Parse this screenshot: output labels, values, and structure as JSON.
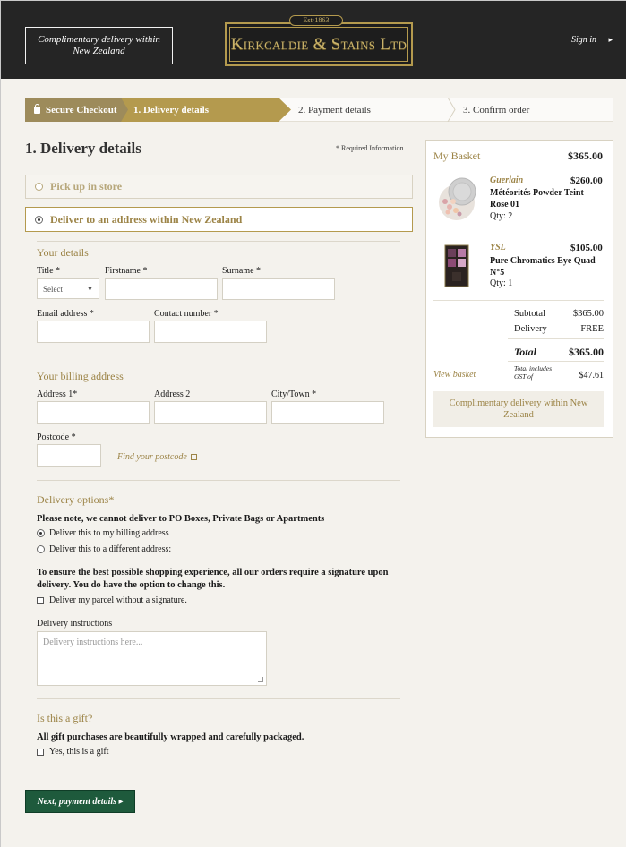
{
  "header": {
    "promo_text": "Complimentary delivery within New Zealand",
    "logo_est": "Est·1863",
    "logo_text": "Kirkcaldie & Stains Ltd",
    "sign_in": "Sign in",
    "sign_in_arrow": "▸"
  },
  "progress": {
    "secure": "Secure Checkout",
    "step1": "1. Delivery details",
    "step2": "2. Payment details",
    "step3": "3. Confirm order"
  },
  "page": {
    "title": "1. Delivery details",
    "required_info": "* Required Information"
  },
  "delivery_method": {
    "pickup": "Pick up in store",
    "address": "Deliver to an address within New Zealand"
  },
  "your_details": {
    "heading": "Your details",
    "title_label": "Title *",
    "title_select": "Select",
    "firstname_label": "Firstname *",
    "surname_label": "Surname *",
    "email_label": "Email address *",
    "contact_label": "Contact number *"
  },
  "billing": {
    "heading": "Your billing address",
    "address1_label": "Address 1*",
    "address2_label": "Address 2",
    "city_label": "City/Town *",
    "postcode_label": "Postcode *",
    "find_postcode": "Find your postcode"
  },
  "delivery_options": {
    "heading": "Delivery options*",
    "po_note": "Please note, we cannot deliver to PO Boxes, Private Bags or Apartments",
    "option_billing": "Deliver this to my billing address",
    "option_different": "Deliver this to a different address:",
    "signature_note": "To ensure the best possible shopping experience, all our orders require a signature upon delivery. You do have the option to change this.",
    "no_signature": "Deliver my parcel without a signature.",
    "instructions_label": "Delivery instructions",
    "instructions_placeholder": "Delivery instructions here..."
  },
  "gift": {
    "heading": "Is this a gift?",
    "note": "All gift purchases are beautifully wrapped and carefully packaged.",
    "checkbox": "Yes, this is a gift"
  },
  "next_button": "Next, payment details ▸",
  "basket": {
    "title": "My Basket",
    "total": "$365.00",
    "items": [
      {
        "brand": "Guerlain",
        "name": "Météorités Powder Teint Rose 01",
        "qty": "Qty: 2",
        "price": "$260.00"
      },
      {
        "brand": "YSL",
        "name": "Pure Chromatics Eye Quad N°5",
        "qty": "Qty: 1",
        "price": "$105.00"
      }
    ],
    "subtotal_label": "Subtotal",
    "subtotal_value": "$365.00",
    "delivery_label": "Delivery",
    "delivery_value": "FREE",
    "total_label": "Total",
    "total_value": "$365.00",
    "view_basket": "View basket",
    "gst_label": "Total includes GST of",
    "gst_value": "$47.61",
    "promo": "Complimentary delivery within New Zealand"
  },
  "colors": {
    "header_bg": "#252525",
    "gold": "#b49a4e",
    "gold_text": "#9c8447",
    "page_bg": "#f4f2ed",
    "button_green": "#1e5a3c"
  }
}
